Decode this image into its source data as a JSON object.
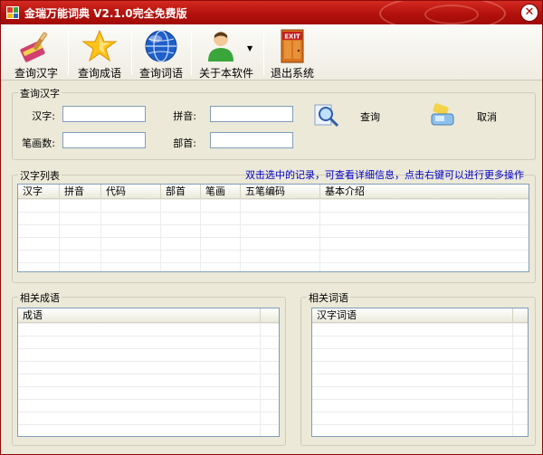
{
  "window": {
    "title": "金瑞万能词典 V2.1.0完全免费版",
    "close_glyph": "✕"
  },
  "toolbar": {
    "items": [
      {
        "label": "查询汉字",
        "icon": "brush-icon"
      },
      {
        "label": "查询成语",
        "icon": "star-icon"
      },
      {
        "label": "查询词语",
        "icon": "globe-icon"
      },
      {
        "label": "关于本软件",
        "icon": "user-icon"
      },
      {
        "label": "退出系统",
        "icon": "exit-door-icon",
        "icon_text": "EXIT"
      }
    ]
  },
  "query": {
    "group_title": "查询汉字",
    "hanzi_label": "汉字:",
    "pinyin_label": "拼音:",
    "stroke_label": "笔画数:",
    "radical_label": "部首:",
    "hanzi_value": "",
    "pinyin_value": "",
    "stroke_value": "",
    "radical_value": "",
    "search_label": "查询",
    "cancel_label": "取消"
  },
  "hanzi_list": {
    "group_title": "汉字列表",
    "hint": "双击选中的记录，可查看详细信息，点击右键可以进行更多操作",
    "columns": [
      "汉字",
      "拼音",
      "代码",
      "部首",
      "笔画",
      "五笔编码",
      "基本介绍"
    ]
  },
  "idioms": {
    "group_title": "相关成语",
    "columns": [
      "成语"
    ]
  },
  "words": {
    "group_title": "相关词语",
    "columns": [
      "汉字词语"
    ]
  },
  "colors": {
    "title_bar": "#b3110c",
    "hint_text": "#0000cc"
  }
}
